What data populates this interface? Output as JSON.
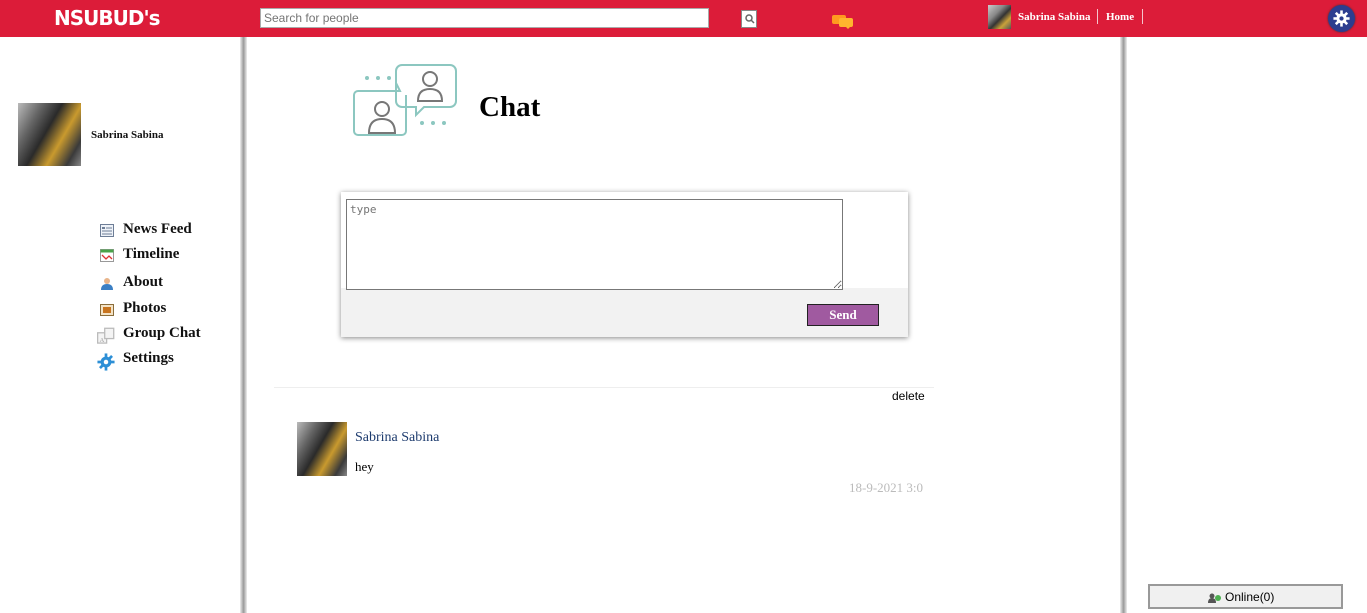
{
  "header": {
    "logo": "NSUBUD's",
    "search_placeholder": "Search for people",
    "user_name": "Sabrina Sabina",
    "home_label": "Home",
    "brand_color": "#dc1c39"
  },
  "sidebar": {
    "profile_name": "Sabrina Sabina",
    "items": [
      {
        "label": "News Feed",
        "icon": "newsfeed-icon"
      },
      {
        "label": "Timeline",
        "icon": "timeline-icon"
      },
      {
        "label": "About",
        "icon": "user-icon"
      },
      {
        "label": "Photos",
        "icon": "photos-icon"
      },
      {
        "label": "Group Chat",
        "icon": "group-chat-icon"
      },
      {
        "label": "Settings",
        "icon": "gear-icon"
      }
    ]
  },
  "main": {
    "title": "Chat",
    "textarea_placeholder": "type",
    "send_label": "Send",
    "send_color": "#a05aa0",
    "delete_label": "delete",
    "messages": [
      {
        "author": "Sabrina Sabina",
        "text": "hey",
        "time": "18-9-2021 3:0"
      }
    ]
  },
  "online": {
    "label": "Online(0)"
  }
}
